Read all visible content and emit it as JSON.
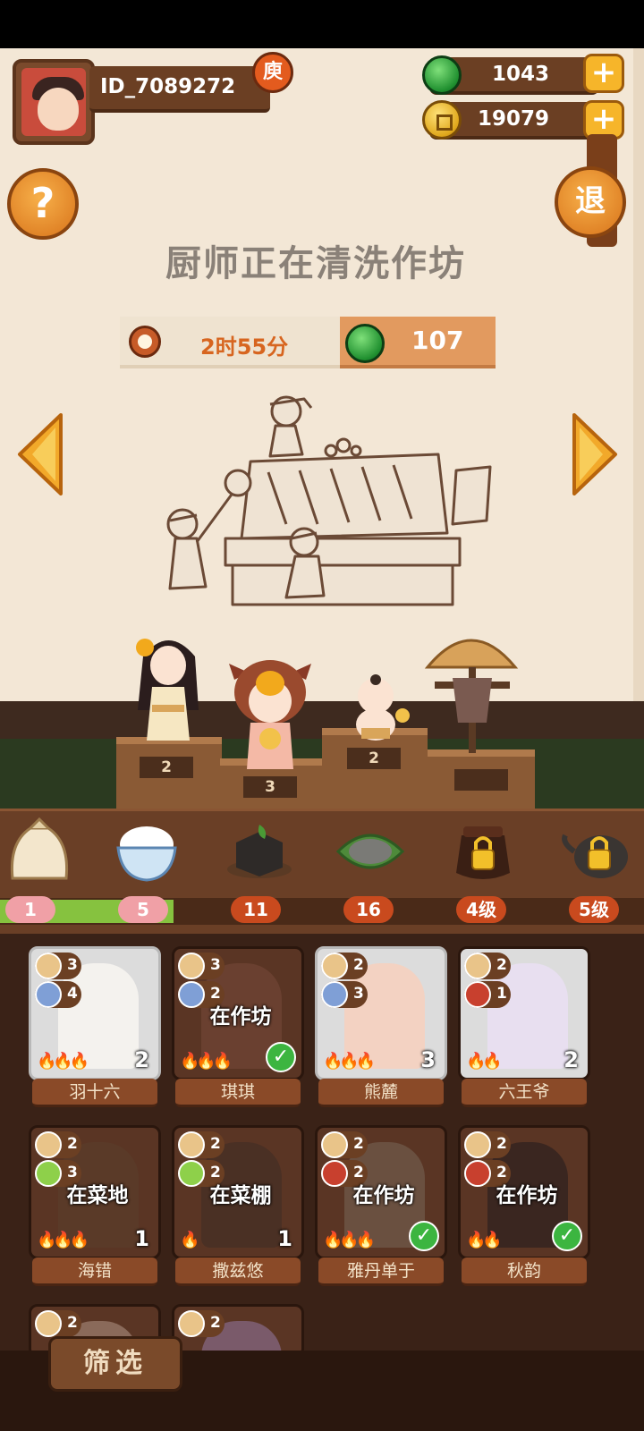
{
  "player": {
    "id_text": "ID_7089272",
    "badge": "庾"
  },
  "currency": {
    "jade": {
      "value": "1043",
      "icon": "jade-icon"
    },
    "coins": {
      "value": "19079",
      "icon": "coin-icon"
    },
    "plus_label": "+"
  },
  "help_label": "?",
  "exit_label": "退",
  "headline": "厨师正在清洗作坊",
  "timer": {
    "text": "2时55分",
    "icon": "alarm-clock-icon"
  },
  "cost": {
    "value": "107",
    "icon": "jade-icon"
  },
  "stage": {
    "pedestals": [
      "2",
      "3",
      "2",
      ""
    ]
  },
  "ingredients": [
    {
      "name": "flour-sack",
      "level": "1",
      "locked": false
    },
    {
      "name": "rice-bowl",
      "level": "5",
      "locked": false
    },
    {
      "name": "tofu",
      "level": "11",
      "locked": false
    },
    {
      "name": "leaf-grain",
      "level": "16",
      "locked": false
    },
    {
      "name": "jar",
      "level": "4级",
      "locked": true
    },
    {
      "name": "teapot",
      "level": "5级",
      "locked": true
    }
  ],
  "chefs": [
    {
      "name": "羽十六",
      "basket": "3",
      "skill_type": "fish",
      "skill": "4",
      "level": "2",
      "status": "",
      "checked": false,
      "flames": 3
    },
    {
      "name": "琪琪",
      "basket": "3",
      "skill_type": "fish",
      "skill": "2",
      "level": "",
      "status": "在作坊",
      "checked": true,
      "flames": 3
    },
    {
      "name": "熊麓",
      "basket": "2",
      "skill_type": "fish",
      "skill": "3",
      "level": "3",
      "status": "",
      "checked": false,
      "flames": 3
    },
    {
      "name": "六王爷",
      "basket": "2",
      "skill_type": "meat",
      "skill": "1",
      "level": "2",
      "status": "",
      "checked": false,
      "flames": 2
    },
    {
      "name": "海错",
      "basket": "2",
      "skill_type": "veg",
      "skill": "3",
      "level": "1",
      "status": "在菜地",
      "checked": false,
      "flames": 3
    },
    {
      "name": "撒兹悠",
      "basket": "2",
      "skill_type": "veg",
      "skill": "2",
      "level": "1",
      "status": "在菜棚",
      "checked": false,
      "flames": 1
    },
    {
      "name": "雅丹单于",
      "basket": "2",
      "skill_type": "meat",
      "skill": "2",
      "level": "",
      "status": "在作坊",
      "checked": true,
      "flames": 3
    },
    {
      "name": "秋韵",
      "basket": "2",
      "skill_type": "meat",
      "skill": "2",
      "level": "",
      "status": "在作坊",
      "checked": true,
      "flames": 2
    },
    {
      "name": "",
      "basket": "2",
      "skill_type": "fish",
      "skill": "",
      "level": "",
      "status": "",
      "checked": false,
      "flames": 0
    },
    {
      "name": "",
      "basket": "2",
      "skill_type": "meat",
      "skill": "",
      "level": "",
      "status": "",
      "checked": false,
      "flames": 0
    }
  ],
  "filter_label": "筛选",
  "colors": {
    "paper": "#f3e7d6",
    "accent_orange": "#d7651f",
    "check_green": "#3cb540",
    "wood": "#6b3f23"
  }
}
